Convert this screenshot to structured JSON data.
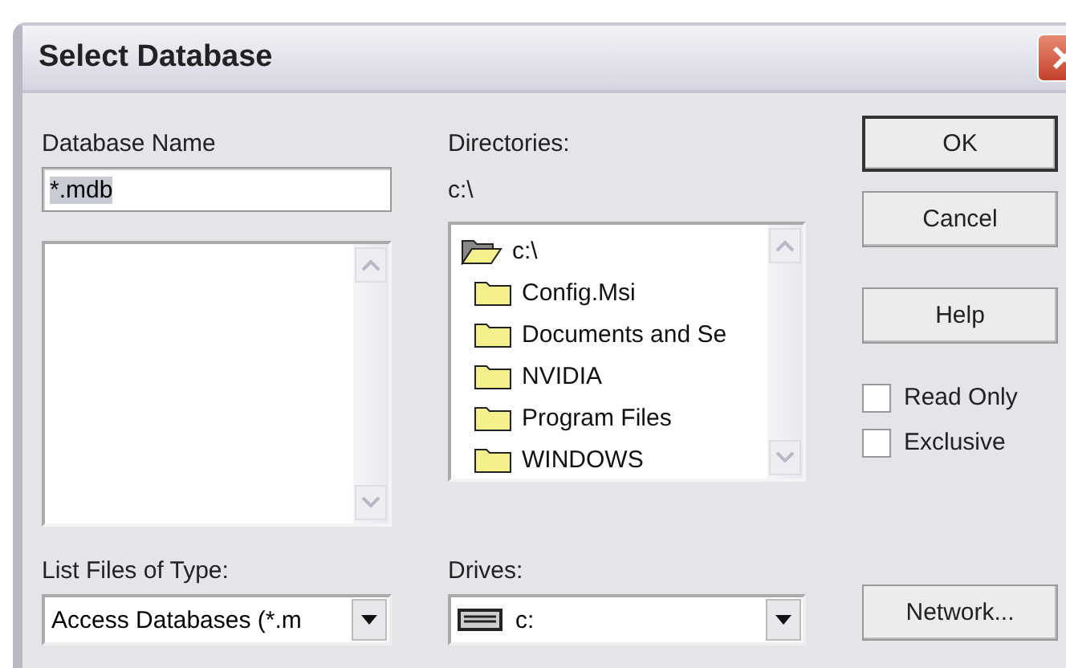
{
  "window": {
    "title": "Select Database"
  },
  "database_name": {
    "label": "Database Name",
    "value": "*.mdb",
    "text_selected": true
  },
  "directories": {
    "label": "Directories:",
    "current": "c:\\",
    "tree": [
      {
        "label": "c:\\",
        "open": true,
        "children": [
          {
            "label": "Config.Msi",
            "open": false
          },
          {
            "label": "Documents and Se",
            "open": false
          },
          {
            "label": "NVIDIA",
            "open": false
          },
          {
            "label": "Program Files",
            "open": false
          },
          {
            "label": "WINDOWS",
            "open": false
          }
        ]
      }
    ]
  },
  "buttons": [
    {
      "label": "OK",
      "default": true
    },
    {
      "label": "Cancel",
      "default": false
    },
    {
      "label": "Help",
      "default": false
    }
  ],
  "options": [
    {
      "label": "Read Only",
      "checked": false
    },
    {
      "label": "Exclusive",
      "checked": false
    }
  ],
  "file_type": {
    "label": "List Files of Type:",
    "value": "Access Databases (*.m"
  },
  "drives": {
    "label": "Drives:",
    "value": "c:"
  },
  "network_button": {
    "label": "Network..."
  }
}
